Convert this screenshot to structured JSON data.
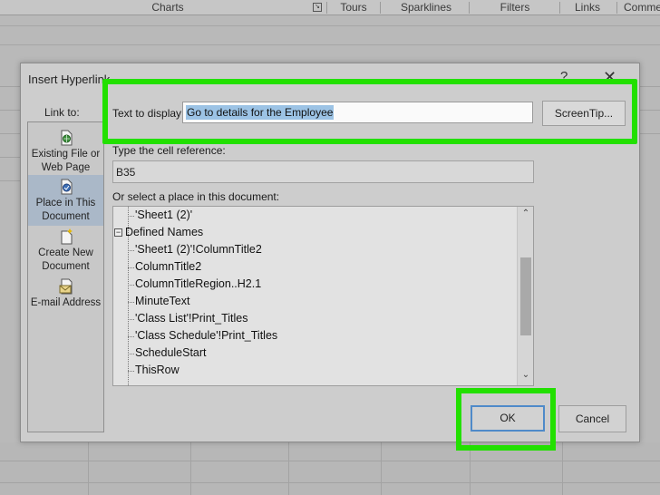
{
  "ribbon": {
    "groups": [
      "Charts",
      "Tours",
      "Sparklines",
      "Filters",
      "Links",
      "Comme"
    ]
  },
  "dialog": {
    "title": "Insert Hyperlink",
    "help_glyph": "?",
    "close_glyph": "✕",
    "link_to_label": "Link to:",
    "places": [
      {
        "line1": "Existing File or",
        "line2": "Web Page",
        "icon": "globe-file-icon",
        "selected": false
      },
      {
        "line1": "Place in This",
        "line2": "Document",
        "icon": "document-place-icon",
        "selected": true
      },
      {
        "line1": "Create New",
        "line2": "Document",
        "icon": "new-document-icon",
        "selected": false
      },
      {
        "line1": "E-mail Address",
        "line2": "",
        "icon": "email-icon",
        "selected": false
      }
    ],
    "text_to_display_label": "Text to display:",
    "text_to_display_value": "Go to details for the Employee",
    "screentip_label": "ScreenTip...",
    "cell_reference_label": "Type the cell reference:",
    "cell_reference_value": "B35",
    "place_in_doc_label": "Or select a place in this document:",
    "tree_items": [
      "'Sheet1 (2)'",
      "Defined Names",
      "'Sheet1 (2)'!ColumnTitle2",
      "ColumnTitle2",
      "ColumnTitleRegion..H2.1",
      "MinuteText",
      "'Class List'!Print_Titles",
      "'Class Schedule'!Print_Titles",
      "ScheduleStart",
      "ThisRow"
    ],
    "expander_glyph": "−",
    "ok_label": "OK",
    "cancel_label": "Cancel"
  },
  "colors": {
    "highlight": "#22e000",
    "selection": "#9cc3e5",
    "selected_place": "#aab8c8"
  }
}
